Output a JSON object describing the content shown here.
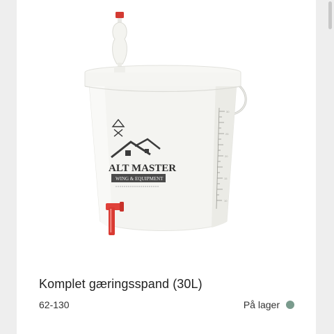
{
  "product": {
    "title": "Komplet gæringsspand (30L)",
    "sku": "62-130",
    "stock_status": "På lager",
    "stock_color": "#7a9b8d",
    "image_alt": "Fermentation bucket with airlock and tap",
    "logo_text": {
      "brand": "ALT MASTER",
      "tagline": "WING & EQUIPMENT"
    }
  },
  "scrollbar": {
    "position": 0
  }
}
